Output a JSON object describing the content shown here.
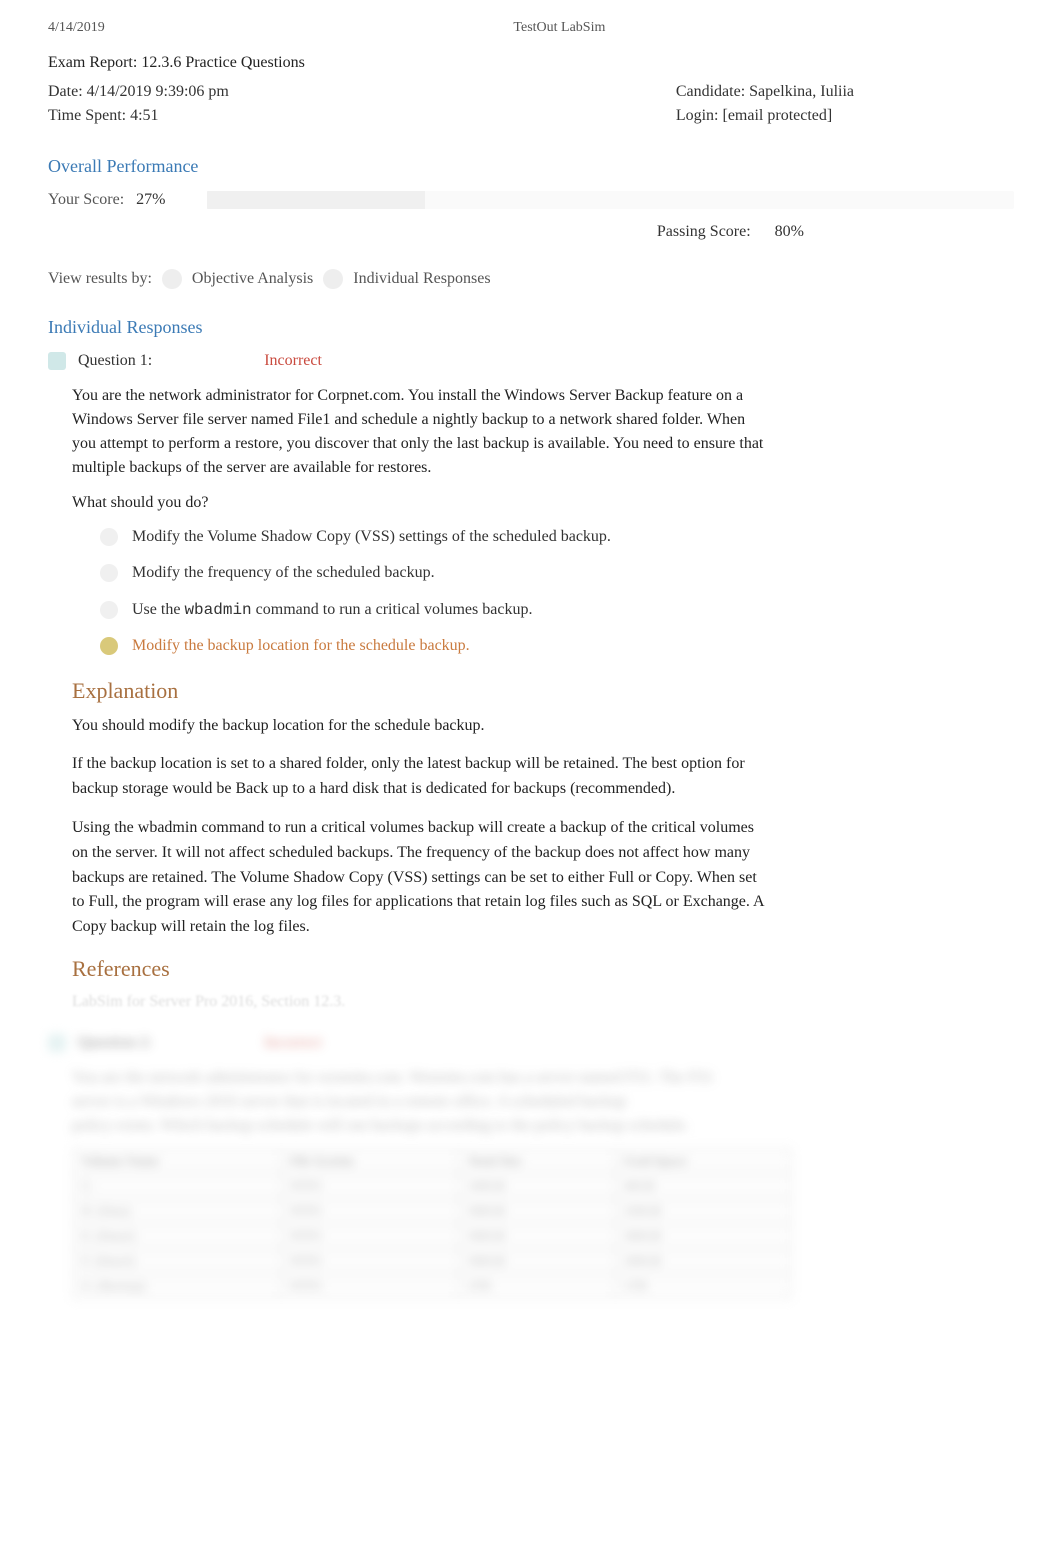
{
  "header": {
    "date": "4/14/2019",
    "app_title": "TestOut LabSim"
  },
  "exam_title": "Exam Report: 12.3.6 Practice Questions",
  "meta": {
    "date_label": "Date: 4/14/2019 9:39:06 pm",
    "time_spent_label": "Time Spent: 4:51",
    "candidate_label": "Candidate: Sapelkina, Iuliia",
    "login_label": "Login: [email protected]"
  },
  "overall_performance": {
    "heading": "Overall Performance",
    "your_score_label": "Your Score:",
    "your_score_value": "27%",
    "passing_score_label": "Passing Score:",
    "passing_score_value": "80%"
  },
  "view_results": {
    "label": "View results by:",
    "option1": "Objective Analysis",
    "option2": "Individual Responses"
  },
  "individual_responses": {
    "heading": "Individual Responses"
  },
  "question1": {
    "label": "Question 1:",
    "status": "Incorrect",
    "body": "You are the network administrator for Corpnet.com. You install the Windows Server Backup feature on a Windows Server file server named File1 and schedule a nightly backup to a network shared folder. When you attempt to perform a restore, you discover that only the last backup is available. You need to ensure that multiple backups of the server are available for restores.",
    "prompt": "What should you do?",
    "answers": [
      {
        "text": "Modify the Volume Shadow Copy (VSS) settings of the scheduled backup.",
        "correct": false
      },
      {
        "text": "Modify the frequency of the scheduled backup.",
        "correct": false
      },
      {
        "text_parts": [
          "Use the ",
          "wbadmin",
          " command to run a critical volumes backup."
        ],
        "correct": false
      },
      {
        "text": "Modify the backup location for the schedule backup.",
        "correct": true
      }
    ],
    "explanation_heading": "Explanation",
    "explanation": [
      "You should modify the backup location for the schedule backup.",
      "If the backup location is set to a shared folder, only the latest backup will be retained. The best option for backup storage would be Back up to a hard disk that is dedicated for backups (recommended).",
      "Using the wbadmin command to run a critical volumes backup will create a backup of the critical volumes on the server. It will not affect scheduled backups. The frequency of the backup does not affect how many backups are retained. The Volume Shadow Copy (VSS) settings can be set to either Full or Copy. When set to Full, the program will erase any log files for applications that retain log files such as SQL or Exchange. A Copy backup will retain the log files."
    ],
    "references_heading": "References",
    "references": "LabSim for Server Pro 2016, Section 12.3."
  },
  "question2_blurred": {
    "label": "Question 2:",
    "status": "Incorrect",
    "body_line1": "You are the network administrator for westsim.com. Westsim.com has a server named FS1. The FS1",
    "body_line2": "server is a Windows 2016 server that is located in a remote office. A scheduled backup",
    "body_line3": "policy exists. Which backup schedule will run backups according to the policy backup schedule.",
    "table": {
      "headers": [
        "Volume Name",
        "File System",
        "Total Size",
        "Used Space"
      ],
      "rows": [
        [
          "C:",
          "NTFS",
          "100GB",
          "40GB"
        ],
        [
          "D: (Data)",
          "NTFS",
          "500GB",
          "250GB"
        ],
        [
          "E: (Data2)",
          "NTFS",
          "500GB",
          "300GB"
        ],
        [
          "F: (Data3)",
          "NTFS",
          "500GB",
          "200GB"
        ],
        [
          "G: (Backup)",
          "NTFS",
          "2TB",
          "1TB"
        ]
      ]
    }
  }
}
